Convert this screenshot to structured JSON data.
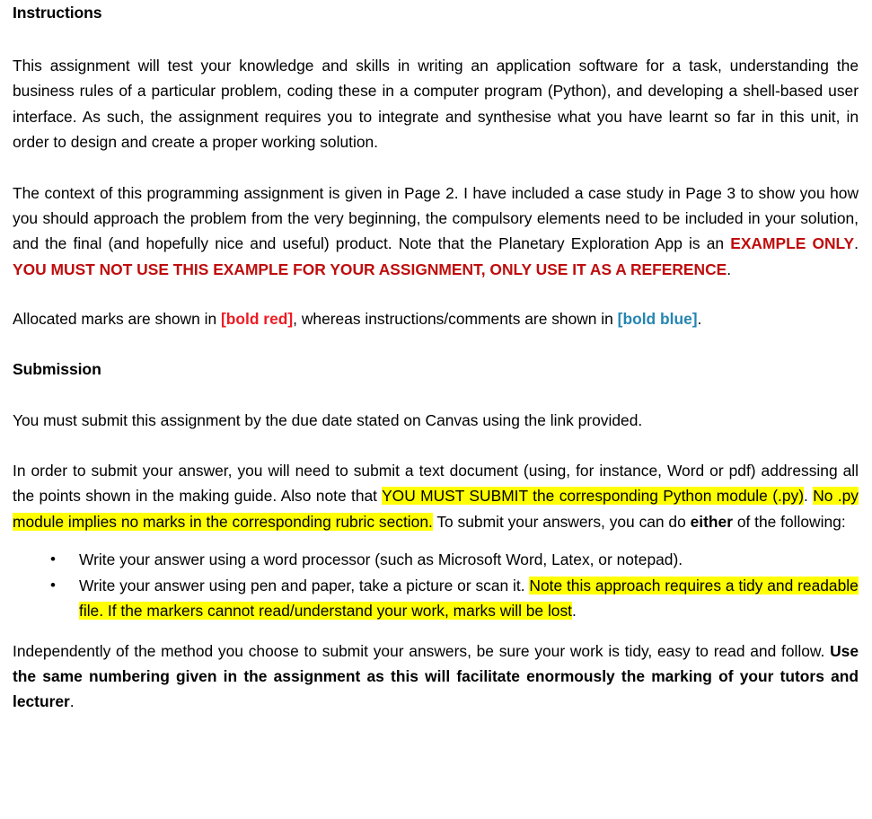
{
  "document": {
    "sections": {
      "instructions_heading": "Instructions",
      "submission_heading": "Submission"
    },
    "paragraphs": {
      "intro": "This assignment will test your knowledge and skills in writing an application software for a task, understanding the business rules of a particular problem, coding these in a computer program (Python), and developing a shell-based user interface. As such, the assignment requires you to integrate and synthesise what you have learnt so far in this unit, in order to design and create a proper working solution.",
      "context_part1": "The context of this programming assignment is given in Page 2. I have included a case study in Page 3 to show you how you should approach the problem from the very beginning, the compulsory elements need to be included in your solution, and the final (and hopefully nice and useful) product. Note that the Planetary Exploration App is an ",
      "context_red1": "EXAMPLE ONLY",
      "context_mid": ". ",
      "context_red2": "YOU MUST NOT USE THIS EXAMPLE FOR YOUR ASSIGNMENT, ONLY USE IT AS A REFERENCE",
      "context_end": ".",
      "marks_part1": "Allocated marks are shown in ",
      "marks_red": "[bold red]",
      "marks_part2": ", whereas instructions/comments are shown in ",
      "marks_blue": "[bold blue]",
      "marks_end": ".",
      "submit_due": "You must submit this assignment by the due date stated on Canvas using the link provided.",
      "order_part1": "In order to submit your answer, you will need to submit a text document (using, for instance, Word or pdf) addressing all the points shown in the making guide. Also note that ",
      "order_hl1": "YOU MUST SUBMIT the corresponding Python module (.py)",
      "order_mid1": ". ",
      "order_hl2": "No .py module implies no marks in the corresponding rubric section.",
      "order_mid2": " To submit your answers, you can do ",
      "order_bold": "either",
      "order_end": " of the following:",
      "final_part1": "Independently of the method you choose to submit your answers, be sure your work is tidy, easy to read and follow. ",
      "final_bold": "Use the same numbering given in the assignment as this will facilitate enormously the marking of your tutors and lecturer",
      "final_end": "."
    },
    "bullets": [
      {
        "marker": "•",
        "text_plain": "Write your answer using a word processor (such as Microsoft Word, Latex, or notepad)."
      },
      {
        "marker": "•",
        "text_lead": "Write your answer using pen and paper, take a picture or scan it. ",
        "text_highlight": "Note this approach requires a tidy and readable file. If the markers cannot read/understand your work, marks will be lost",
        "text_tail": "."
      }
    ],
    "colors": {
      "dark_red": "#BF0D0D",
      "bright_red": "#ED1C24",
      "bold_blue": "#2585B2",
      "highlight_yellow": "#FFFF00",
      "body_text": "#000000",
      "page_background": "#FFFFFF"
    }
  }
}
